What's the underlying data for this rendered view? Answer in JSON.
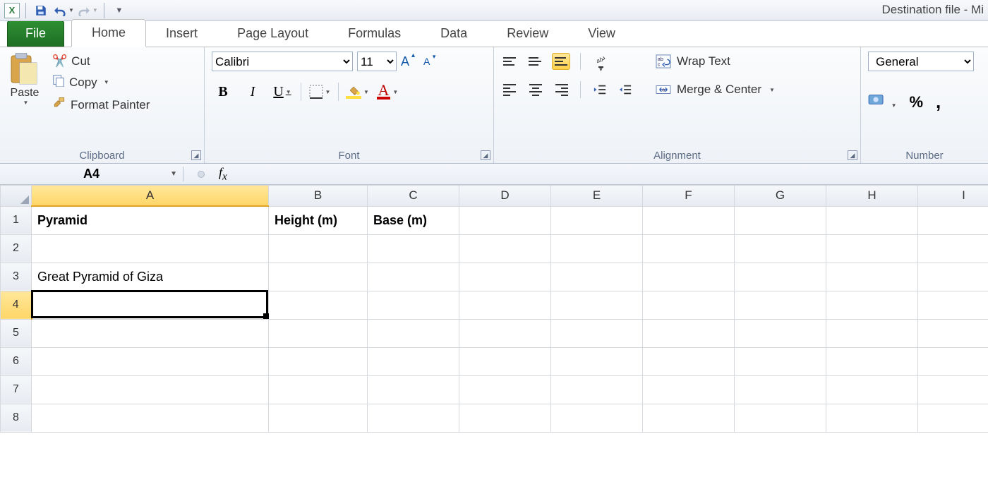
{
  "window": {
    "title": "Destination file  -  Mi"
  },
  "qat": {
    "save": "Save",
    "undo": "Undo",
    "redo": "Redo"
  },
  "tabs": {
    "file": "File",
    "items": [
      "Home",
      "Insert",
      "Page Layout",
      "Formulas",
      "Data",
      "Review",
      "View"
    ],
    "active": 0
  },
  "ribbon": {
    "clipboard": {
      "label": "Clipboard",
      "paste": "Paste",
      "cut": "Cut",
      "copy": "Copy",
      "format_painter": "Format Painter"
    },
    "font": {
      "label": "Font",
      "name": "Calibri",
      "size": "11"
    },
    "alignment": {
      "label": "Alignment",
      "wrap": "Wrap Text",
      "merge": "Merge & Center"
    },
    "number": {
      "label": "Number",
      "format": "General",
      "percent": "%",
      "comma": ","
    }
  },
  "namebox": "A4",
  "formula": "",
  "sheet": {
    "columns": [
      "A",
      "B",
      "C",
      "D",
      "E",
      "F",
      "G",
      "H",
      "I"
    ],
    "rows": [
      "1",
      "2",
      "3",
      "4",
      "5",
      "6",
      "7",
      "8"
    ],
    "cells": {
      "A1": "Pyramid",
      "B1": "Height (m)",
      "C1": "Base (m)",
      "A3": "Great Pyramid of Giza"
    },
    "selected": "A4"
  }
}
